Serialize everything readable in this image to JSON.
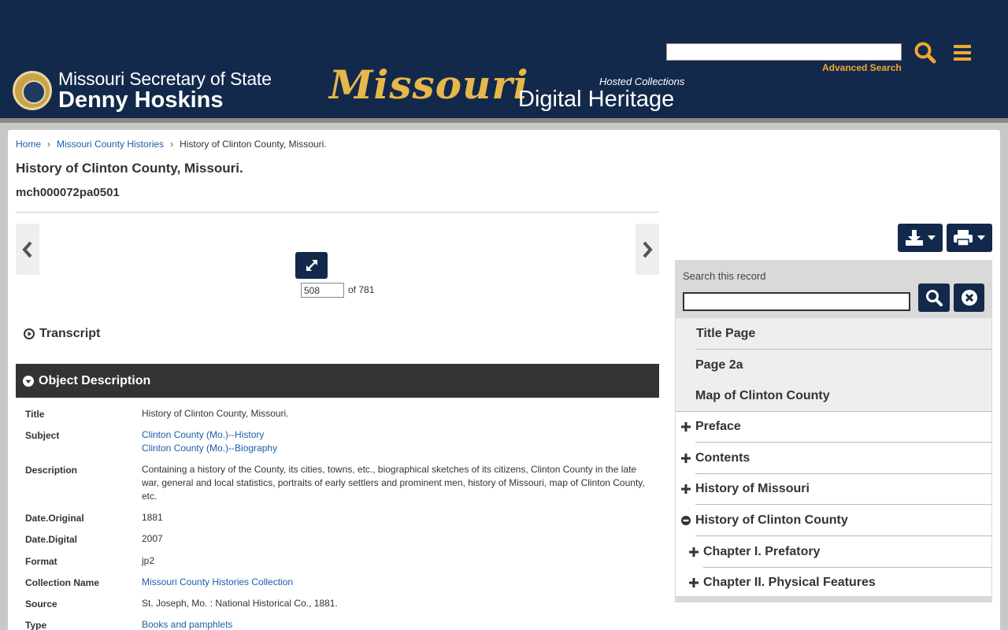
{
  "header": {
    "sos_line1": "Missouri Secretary of State",
    "sos_line2": "Denny Hoskins",
    "mdh_missouri": "Missouri",
    "mdh_digital_heritage": "Digital Heritage",
    "mdh_hosted": "Hosted Collections",
    "search_value": "",
    "advanced_search": "Advanced Search",
    "colors": {
      "navy": "#13294b",
      "gold": "#f0a830"
    }
  },
  "breadcrumb": {
    "home": "Home",
    "collection": "Missouri County Histories",
    "current": "History of Clinton County, Missouri.",
    "separator": "›"
  },
  "page": {
    "title": "History of Clinton County, Missouri.",
    "id": "mch000072pa0501"
  },
  "viewer": {
    "page_number": "508",
    "of_text": "of 781"
  },
  "sections": {
    "transcript": "Transcript",
    "object_description": "Object Description"
  },
  "metadata": [
    {
      "label": "Title",
      "values": [
        "History of Clinton County, Missouri."
      ],
      "link": false
    },
    {
      "label": "Subject",
      "values": [
        "Clinton County (Mo.)--History",
        "Clinton County (Mo.)--Biography"
      ],
      "link": true
    },
    {
      "label": "Description",
      "values": [
        "Containing a history of the County, its cities, towns, etc., biographical sketches of its citizens, Clinton County in the late war, general and local statistics, portraits of early settlers and prominent men, history of Missouri, map of Clinton County, etc."
      ],
      "link": false
    },
    {
      "label": "Date.Original",
      "values": [
        "1881"
      ],
      "link": false
    },
    {
      "label": "Date.Digital",
      "values": [
        "2007"
      ],
      "link": false
    },
    {
      "label": "Format",
      "values": [
        "jp2"
      ],
      "link": false
    },
    {
      "label": "Collection Name",
      "values": [
        "Missouri County Histories Collection"
      ],
      "link": true
    },
    {
      "label": "Source",
      "values": [
        "St. Joseph, Mo. : National Historical Co., 1881."
      ],
      "link": false
    },
    {
      "label": "Type",
      "values": [
        "Books and pamphlets"
      ],
      "link": true
    }
  ],
  "panel": {
    "search_label": "Search this record",
    "search_value": "",
    "toc": [
      {
        "label": "Title Page",
        "state": "leaf"
      },
      {
        "label": "Page 2a",
        "state": "leaf"
      },
      {
        "label": "Map of Clinton County",
        "state": "leaf"
      },
      {
        "label": "Preface",
        "state": "collapsed"
      },
      {
        "label": "Contents",
        "state": "collapsed"
      },
      {
        "label": "History of Missouri",
        "state": "collapsed"
      },
      {
        "label": "History of Clinton County",
        "state": "expanded"
      },
      {
        "label": "Chapter I. Prefatory",
        "state": "collapsed"
      },
      {
        "label": "Chapter II. Physical Features",
        "state": "collapsed"
      }
    ]
  }
}
